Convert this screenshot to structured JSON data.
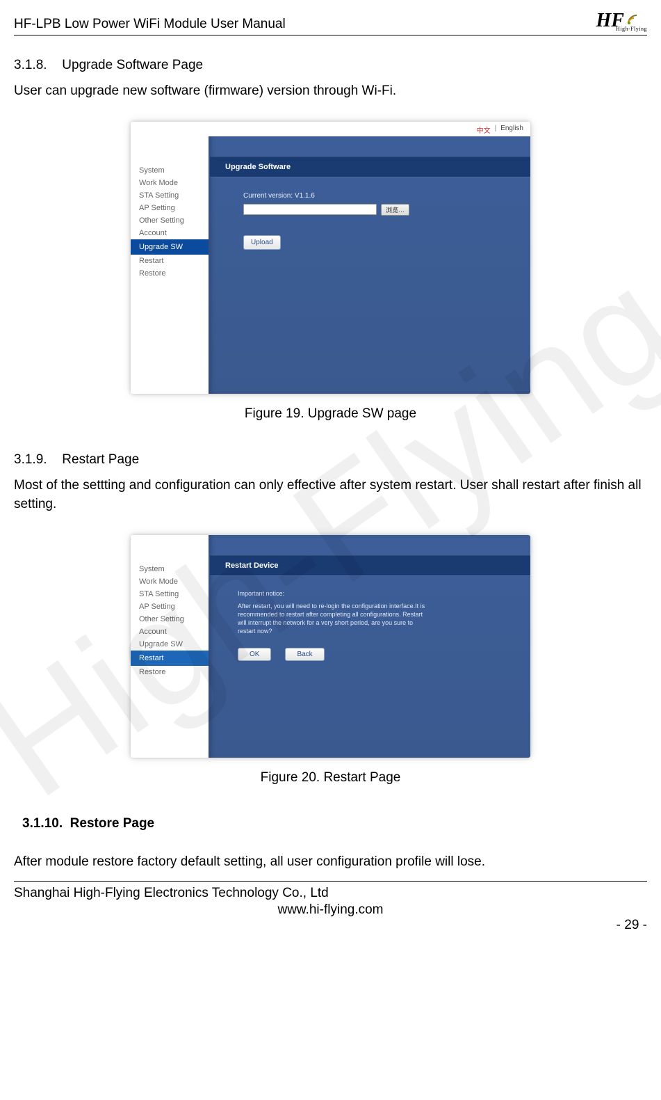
{
  "header": {
    "title": "HF-LPB Low Power WiFi Module User Manual",
    "logo_text": "HF",
    "logo_sub": "High-Flying"
  },
  "watermark": "High-Flying",
  "section_318": {
    "num": "3.1.8.",
    "title": "Upgrade Software Page",
    "text": "User can upgrade new software (firmware) version through Wi-Fi."
  },
  "fig19": {
    "lang_cn": "中文",
    "lang_sep": "|",
    "lang_en": "English",
    "nav": [
      "System",
      "Work Mode",
      "STA Setting",
      "AP Setting",
      "Other Setting",
      "Account",
      "Upgrade SW",
      "Restart",
      "Restore"
    ],
    "active_index": 6,
    "panel_title": "Upgrade Software",
    "version_label": "Current version: V1.1.6",
    "browse_label": "浏览…",
    "upload_label": "Upload",
    "caption": "Figure 19.    Upgrade SW page"
  },
  "section_319": {
    "num": "3.1.9.",
    "title": "Restart Page",
    "text": "Most of the settting and configuration can only effective after system restart. User shall restart after finish all setting."
  },
  "fig20": {
    "nav": [
      "System",
      "Work Mode",
      "STA Setting",
      "AP Setting",
      "Other Setting",
      "Account",
      "Upgrade SW",
      "Restart",
      "Restore"
    ],
    "active_index": 7,
    "panel_title": "Restart Device",
    "notice_title": "Important notice:",
    "notice_body": "After restart, you will need to re-login the configuration interface.It is recommended to restart after completing all configurations. Restart will interrupt the network for a very short period, are you sure to restart now?",
    "ok": "OK",
    "back": "Back",
    "caption": "Figure 20.    Restart Page"
  },
  "section_3110": {
    "num": "3.1.10.",
    "title": "Restore Page",
    "text": "After module restore factory default setting, all user configuration profile will lose."
  },
  "footer": {
    "company": "Shanghai High-Flying Electronics Technology Co., Ltd",
    "url": "www.hi-flying.com",
    "page": "- 29 -"
  }
}
